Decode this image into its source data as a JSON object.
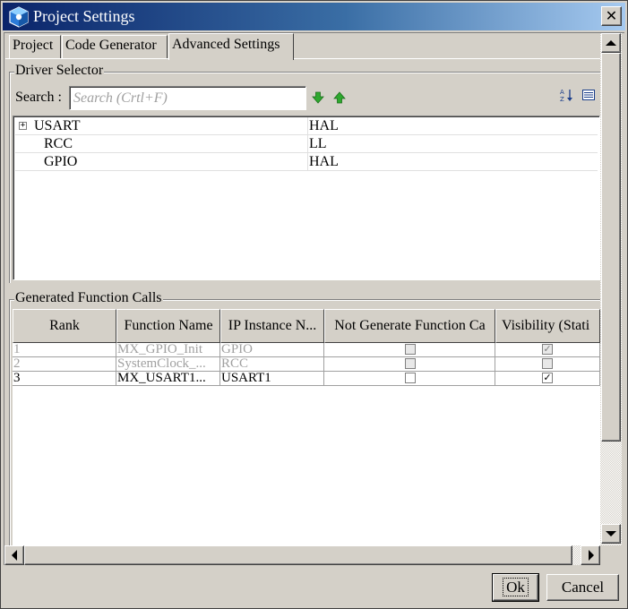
{
  "window": {
    "title": "Project Settings",
    "close_glyph": "✕"
  },
  "tabs": [
    {
      "label": "Project",
      "active": false
    },
    {
      "label": "Code Generator",
      "active": false
    },
    {
      "label": "Advanced Settings",
      "active": true
    }
  ],
  "driver_selector": {
    "group_title": "Driver Selector",
    "search_label": "Search :",
    "search_placeholder": "Search (Crtl+F)",
    "search_value": "",
    "move_down_icon": "arrow-down-green",
    "move_up_icon": "arrow-up-green",
    "sort_icon": "sort-az",
    "list_icon": "list-view",
    "rows": [
      {
        "name": "USART",
        "value": "HAL",
        "expandable": true,
        "expander_glyph": "+"
      },
      {
        "name": "RCC",
        "value": "LL",
        "expandable": false
      },
      {
        "name": "GPIO",
        "value": "HAL",
        "expandable": false
      }
    ]
  },
  "function_calls": {
    "group_title": "Generated Function Calls",
    "columns": [
      "Rank",
      "Function Name",
      "IP Instance N...",
      "Not Generate Function Ca",
      "Visibility (Stati"
    ],
    "rows": [
      {
        "rank": "1",
        "function": "MX_GPIO_Init",
        "instance": "GPIO",
        "not_generate": false,
        "visibility": true,
        "enabled": false
      },
      {
        "rank": "2",
        "function": "SystemClock_...",
        "instance": "RCC",
        "not_generate": false,
        "visibility": false,
        "enabled": false
      },
      {
        "rank": "3",
        "function": "MX_USART1...",
        "instance": "USART1",
        "not_generate": false,
        "visibility": true,
        "enabled": true
      }
    ],
    "check_glyph": "✓"
  },
  "buttons": {
    "ok": "Ok",
    "cancel": "Cancel"
  },
  "colors": {
    "title_start": "#0a246a",
    "title_end": "#a6caf0",
    "face": "#d4d0c8",
    "arrow_green": "#2ea82e"
  }
}
